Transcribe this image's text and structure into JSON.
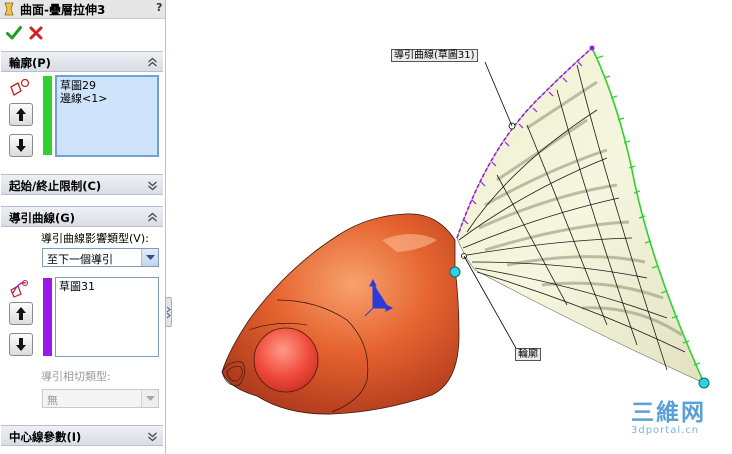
{
  "window": {
    "title": "曲面-疊層拉伸3",
    "help": "?"
  },
  "actions": {
    "ok_icon": "checkmark-icon",
    "cancel_icon": "x-icon"
  },
  "profile_group": {
    "title": "輪廓(P)",
    "items": [
      "草圖29",
      "邊線<1>"
    ],
    "color": "#2fd12f"
  },
  "start_end_group": {
    "title": "起始/終止限制(C)"
  },
  "guide_group": {
    "title": "導引曲線(G)",
    "influence_label": "導引曲線影響類型(V):",
    "influence_value": "至下一個導引",
    "items": [
      "草圖31"
    ],
    "color": "#9a19e8",
    "tangency_label": "導引相切類型:",
    "tangency_value": "無"
  },
  "centerline_group": {
    "title": "中心線參數(I)"
  },
  "viewport": {
    "callouts": {
      "guide_curve": "導引曲線(草圖31)",
      "profile": "輪廓"
    },
    "body_color": "#e0582a",
    "surface_color": "#efefd2"
  },
  "watermark": {
    "logo": "三維网",
    "site": "3dportal.cn"
  }
}
